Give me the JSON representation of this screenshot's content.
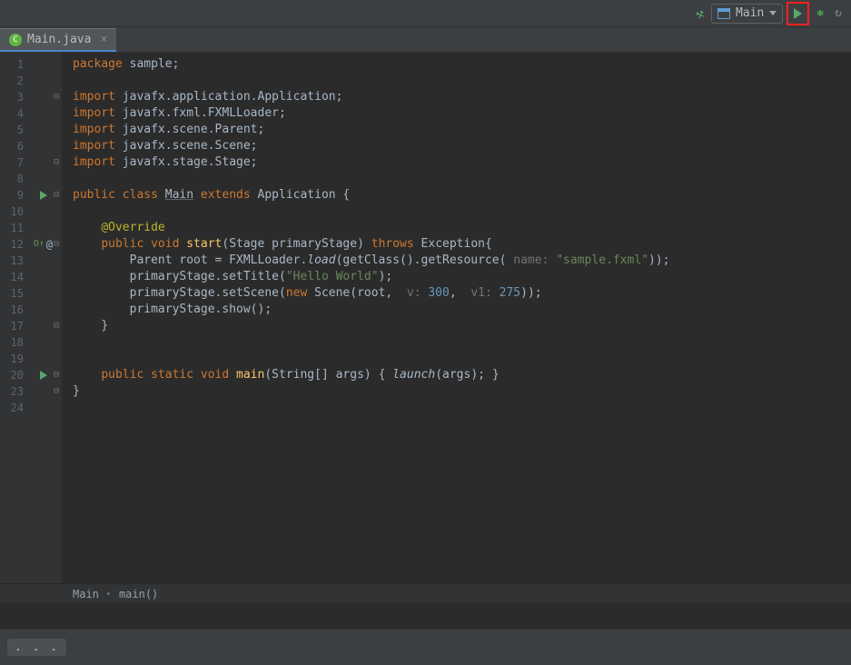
{
  "toolbar": {
    "config_label": "Main"
  },
  "tab": {
    "filename": "Main.java",
    "close": "×"
  },
  "breadcrumb": {
    "class": "Main",
    "method": "main()"
  },
  "status": {
    "ellipsis": ". . ."
  },
  "code": {
    "lines": [
      {
        "n": "1",
        "html": "<span class='kw'>package</span> sample;"
      },
      {
        "n": "2",
        "html": ""
      },
      {
        "n": "3",
        "html": "<span class='kw'>import</span> javafx.application.Application;",
        "fold": "⊟"
      },
      {
        "n": "4",
        "html": "<span class='kw'>import</span> javafx.fxml.FXMLLoader;"
      },
      {
        "n": "5",
        "html": "<span class='kw'>import</span> javafx.scene.Parent;"
      },
      {
        "n": "6",
        "html": "<span class='kw'>import</span> javafx.scene.Scene;"
      },
      {
        "n": "7",
        "html": "<span class='kw'>import</span> javafx.stage.Stage;",
        "fold": "⊟"
      },
      {
        "n": "8",
        "html": ""
      },
      {
        "n": "9",
        "html": "<span class='kw'>public class</span> <span class='underline'>Main</span> <span class='kw'>extends</span> Application {",
        "run": true,
        "fold": "⊟"
      },
      {
        "n": "10",
        "html": ""
      },
      {
        "n": "11",
        "html": "    <span class='ann'>@Override</span>"
      },
      {
        "n": "12",
        "html": "    <span class='kw'>public void</span> <span class='method'>start</span>(Stage primaryStage) <span class='kw'>throws</span> Exception{",
        "override": true,
        "at": true,
        "fold": "⊟"
      },
      {
        "n": "13",
        "html": "        Parent root = FXMLLoader.<span class='italic'>load</span>(getClass().getResource( <span class='param'>name:</span> <span class='str'>\"sample.fxml\"</span>));"
      },
      {
        "n": "14",
        "html": "        primaryStage.setTitle(<span class='str'>\"Hello World\"</span>);"
      },
      {
        "n": "15",
        "html": "        primaryStage.setScene(<span class='kw'>new</span> Scene(root,  <span class='param'>v:</span> <span class='num'>300</span>,  <span class='param'>v1:</span> <span class='num'>275</span>));"
      },
      {
        "n": "16",
        "html": "        primaryStage.show();"
      },
      {
        "n": "17",
        "html": "    }",
        "fold": "⊟"
      },
      {
        "n": "18",
        "html": ""
      },
      {
        "n": "19",
        "html": ""
      },
      {
        "n": "20",
        "html": "    <span class='kw'>public static void</span> <span class='method'>main</span>(String[] args) { <span class='italic'>launch</span>(args); }",
        "run": true,
        "fold": "⊟"
      },
      {
        "n": "23",
        "html": "}",
        "fold": "⊟"
      },
      {
        "n": "24",
        "html": ""
      }
    ]
  }
}
